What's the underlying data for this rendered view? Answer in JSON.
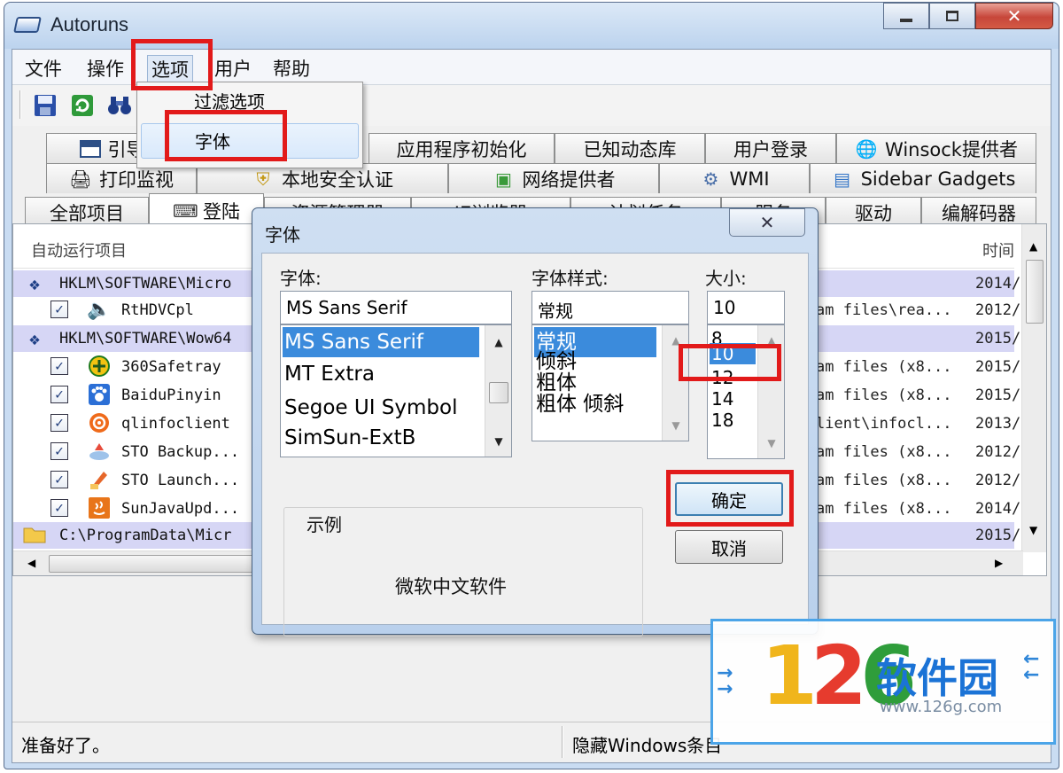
{
  "window": {
    "title": "Autoruns"
  },
  "menu": [
    "文件",
    "操作",
    "选项",
    "用户",
    "帮助"
  ],
  "options_menu": {
    "items": [
      "过滤选项",
      "字体"
    ],
    "highlighted": "字体"
  },
  "tabs": {
    "row1": [
      "引导执",
      "应用程序初始化",
      "已知动态库",
      "用户登录",
      "Winsock提供者"
    ],
    "row2": [
      "打印监视",
      "本地安全认证",
      "网络提供者",
      "WMI",
      "Sidebar Gadgets"
    ],
    "row3": [
      "全部项目",
      "登陆",
      "资源管理器",
      "IE浏览器",
      "计划任务",
      "服务",
      "驱动",
      "编解码器"
    ]
  },
  "list": {
    "header": {
      "col1": "自动运行项目",
      "time": "时间"
    },
    "rows": [
      {
        "type": "group",
        "name": "HKLM\\SOFTWARE\\Micro",
        "time": "2014/"
      },
      {
        "type": "item",
        "name": "RtHDVCpl",
        "path": "am files\\rea...",
        "time": "2012/"
      },
      {
        "type": "group",
        "name": "HKLM\\SOFTWARE\\Wow64",
        "time": "2015/"
      },
      {
        "type": "item",
        "name": "360Safetray",
        "path": "am files (x8...",
        "time": "2015/"
      },
      {
        "type": "item",
        "name": "BaiduPinyin",
        "path": "am files (x8...",
        "time": "2015/"
      },
      {
        "type": "item",
        "name": "qlinfoclient",
        "path": "lient\\infocl...",
        "time": "2013/"
      },
      {
        "type": "item",
        "name": "STO Backup...",
        "path": "am files (x8...",
        "time": "2012/"
      },
      {
        "type": "item",
        "name": "STO Launch...",
        "path": "am files (x8...",
        "time": "2012/"
      },
      {
        "type": "item",
        "name": "SunJavaUpd...",
        "path": "am files (x8...",
        "time": "2014/"
      },
      {
        "type": "folder",
        "name": "C:\\ProgramData\\Micr",
        "time": "2015/"
      }
    ]
  },
  "status": {
    "left": "准备好了。",
    "right": "隐藏Windows条目"
  },
  "font_dialog": {
    "title": "字体",
    "font_label": "字体:",
    "style_label": "字体样式:",
    "size_label": "大小:",
    "font_value": "MS Sans Serif",
    "style_value": "常规",
    "size_value": "10",
    "fonts": [
      "MS Sans Serif",
      "MT Extra",
      "Segoe UI Symbol",
      "SimSun-ExtB"
    ],
    "styles": [
      "常规",
      "倾斜",
      "粗体",
      "粗体 倾斜"
    ],
    "sizes": [
      "8",
      "10",
      "12",
      "14",
      "18"
    ],
    "sample_label": "示例",
    "sample_text": "微软中文软件",
    "ok": "确定",
    "cancel": "取消",
    "close_glyph": "✕"
  },
  "watermark": {
    "num1": "1",
    "num2": "2",
    "num3": "6",
    "brand": "软件园",
    "url": "www.126g.com"
  },
  "colors": {
    "selection": "#3b8bdc",
    "highlight_box": "#e21a1a",
    "group_row": "#d6d6f5"
  }
}
